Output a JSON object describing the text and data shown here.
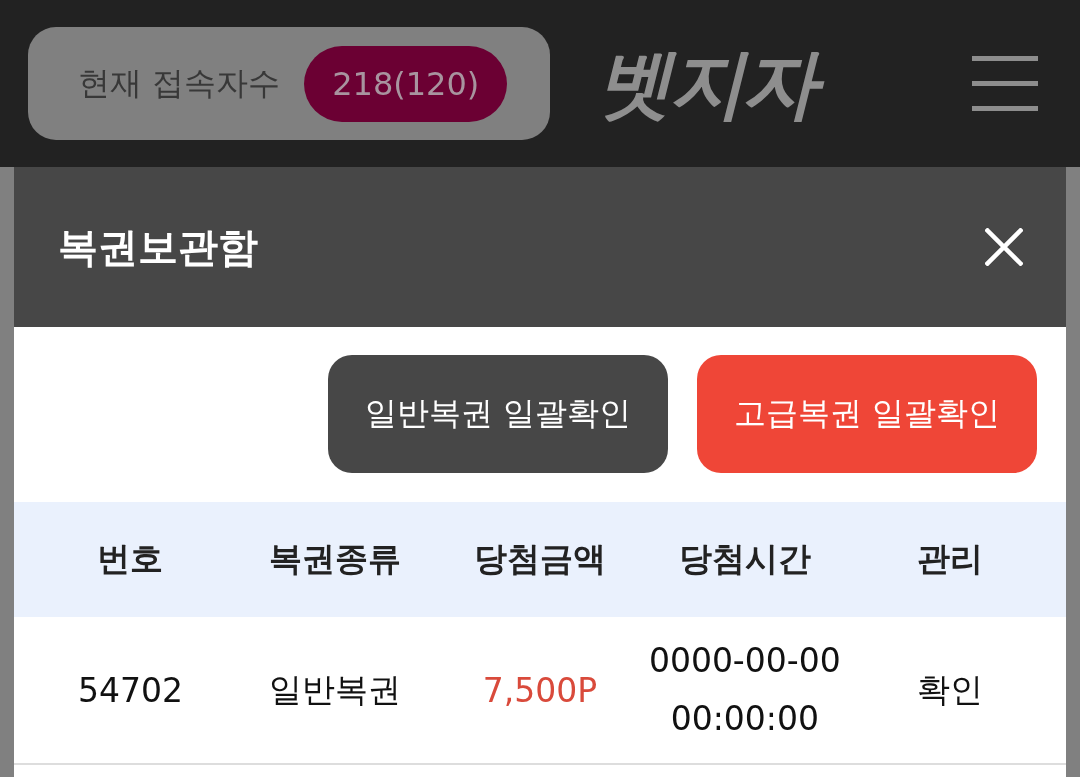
{
  "header": {
    "online_label": "현재 접속자수",
    "online_count": "218(120)",
    "logo": "벳지자"
  },
  "modal": {
    "title": "복권보관함",
    "actions": [
      {
        "label": "일반복권 일괄확인",
        "kind": "normal"
      },
      {
        "label": "고급복권 일괄확인",
        "kind": "premium"
      }
    ],
    "table": {
      "columns": [
        "번호",
        "복권종류",
        "당첨금액",
        "당첨시간",
        "관리"
      ],
      "rows": [
        {
          "number": "54702",
          "type": "일반복권",
          "amount": "7,500P",
          "time": "0000-00-00 00:00:00",
          "action": "확인"
        }
      ]
    }
  }
}
